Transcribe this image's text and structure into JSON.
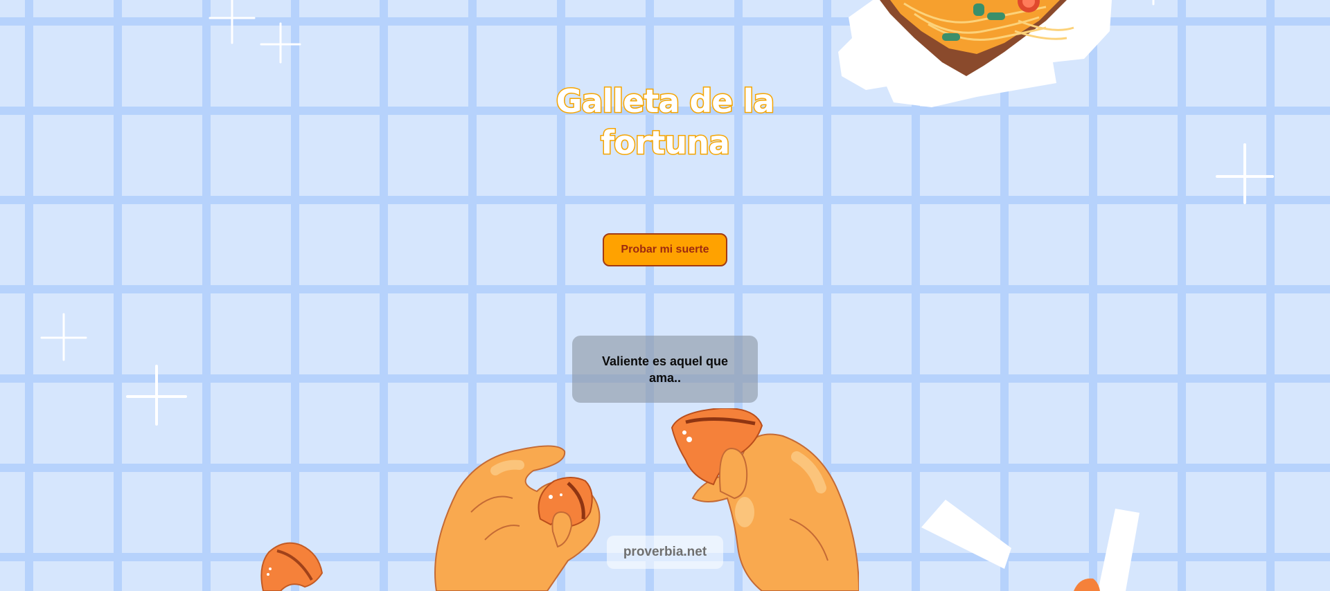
{
  "header": {
    "title": "Galleta de la fortuna"
  },
  "actions": {
    "try_luck_label": "Probar mi suerte"
  },
  "fortune": {
    "message": "Valiente es aquel que ama.."
  },
  "footer": {
    "credit": "proverbia.net"
  },
  "colors": {
    "background": "#d6e6fd",
    "grid_lines": "#b6d2fc",
    "title_outline": "#f6a500",
    "button_fill": "#ffa200",
    "button_border": "#a13a14",
    "cookie": "#f5813a",
    "hands": "#f9a94f"
  }
}
